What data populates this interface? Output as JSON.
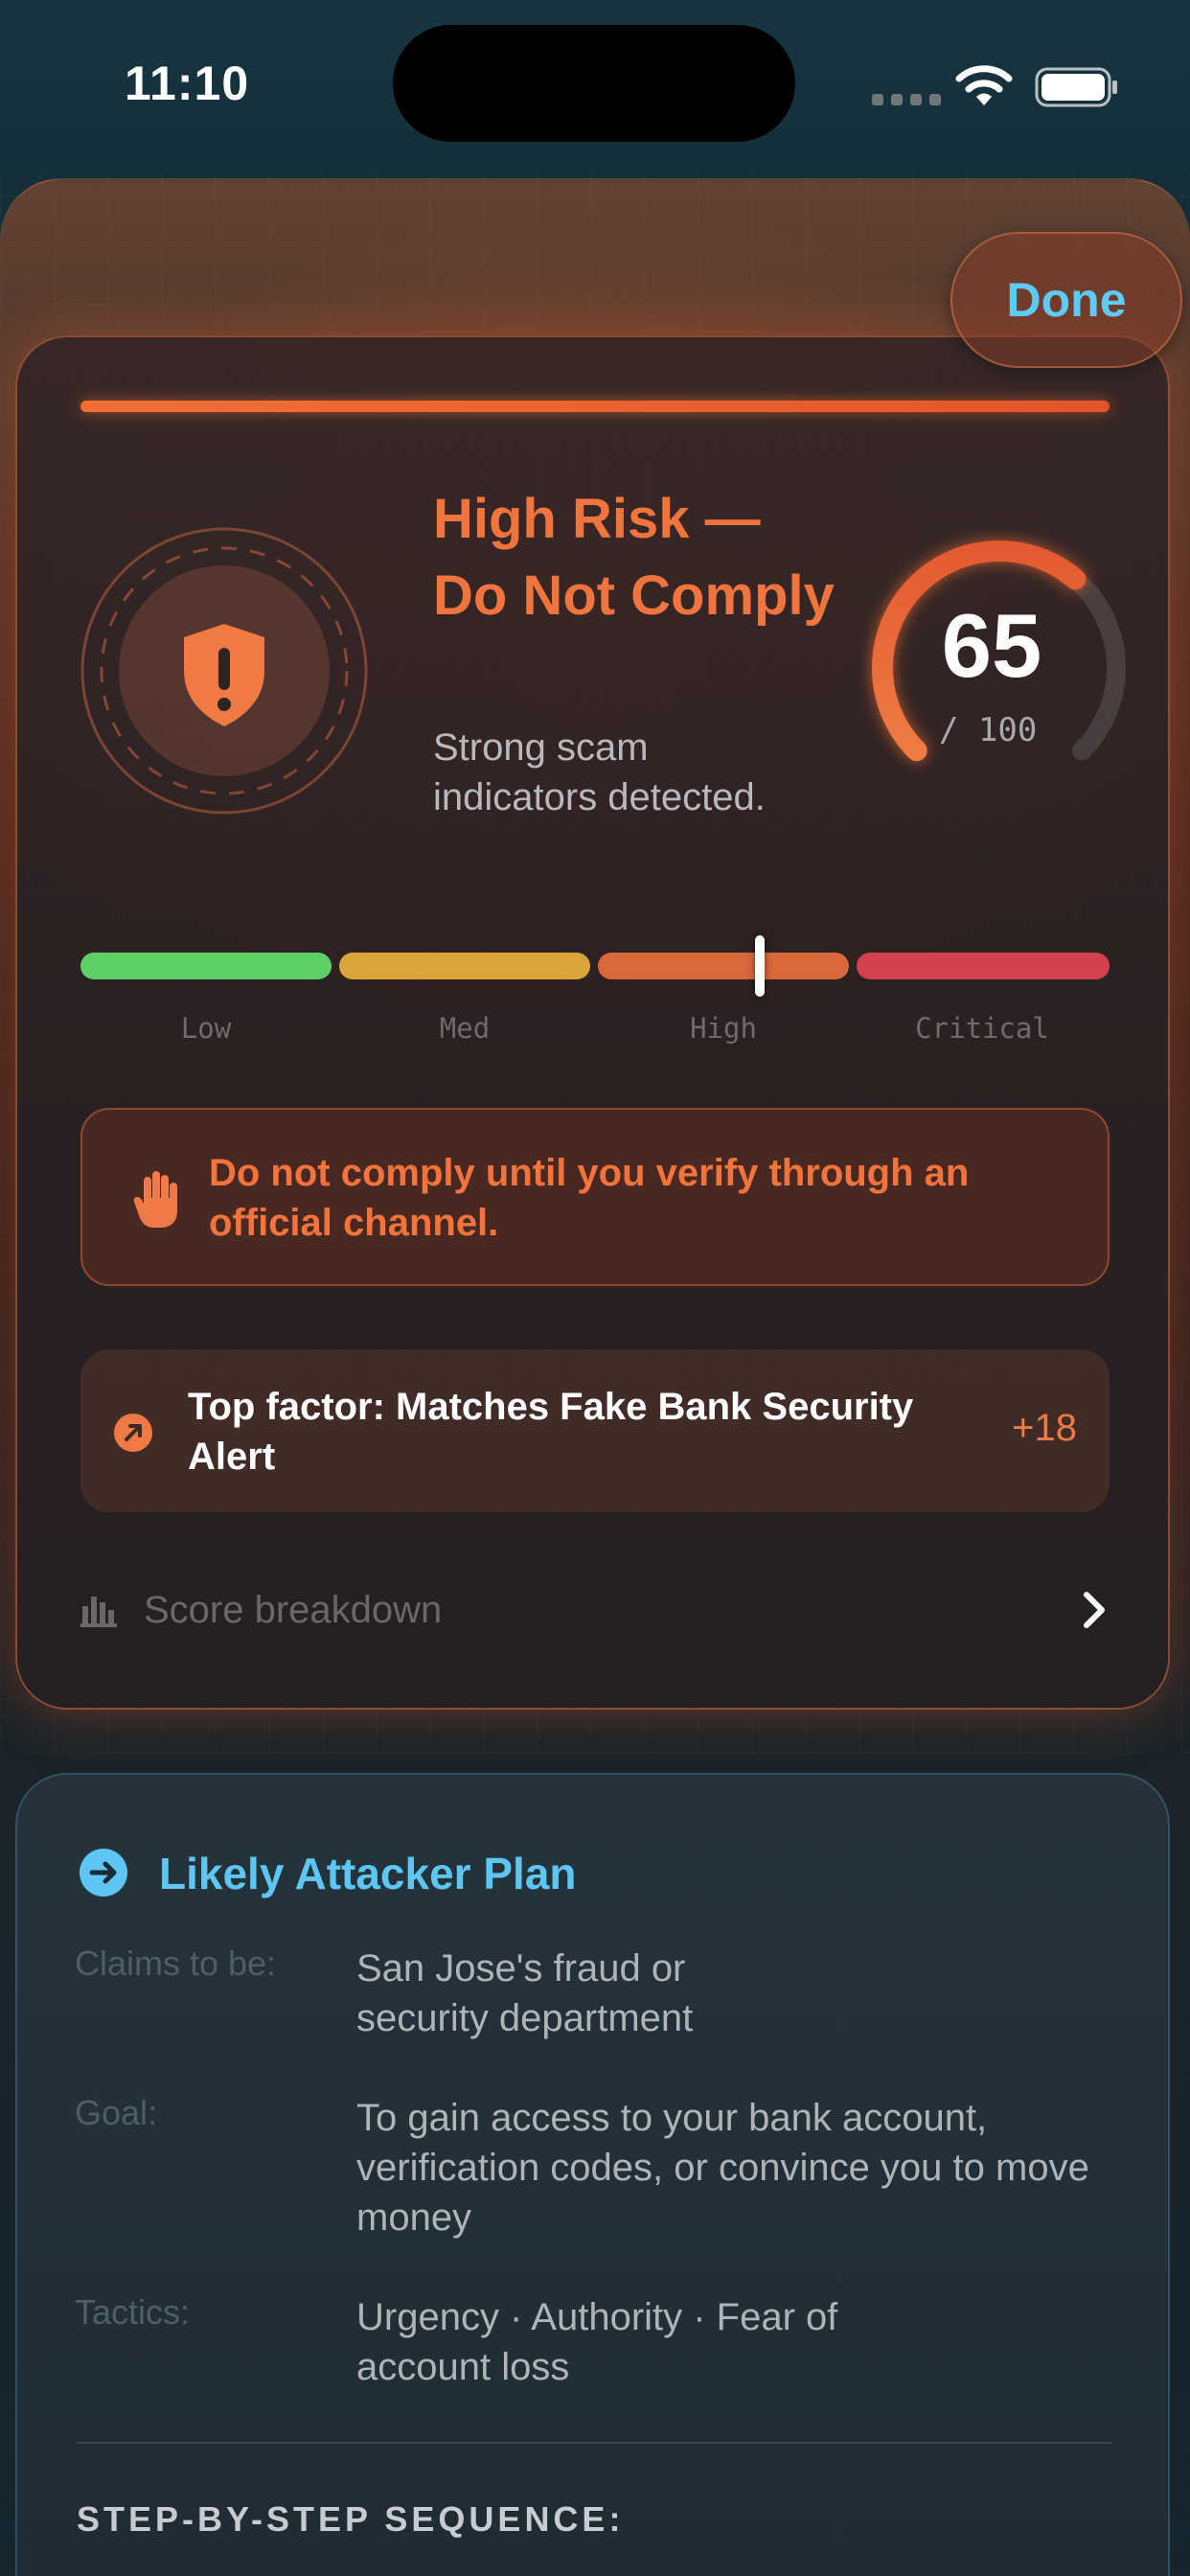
{
  "status_bar": {
    "time": "11:10"
  },
  "header": {
    "done_label": "Done"
  },
  "risk": {
    "title": "High Risk — Do Not Comply",
    "subtitle": "Strong scam indicators detected.",
    "score": "65",
    "score_max": "/ 100",
    "score_fraction": 0.65,
    "scale_labels": [
      "Low",
      "Med",
      "High",
      "Critical"
    ],
    "scale_position_fraction": 0.66,
    "accent_color": "#f0743e"
  },
  "warning": {
    "text": "Do not comply until you verify through an official channel."
  },
  "top_factor": {
    "text": "Top factor: Matches Fake Bank Security Alert",
    "score": "+18"
  },
  "breakdown": {
    "label": "Score breakdown"
  },
  "attacker_plan": {
    "title": "Likely Attacker Plan",
    "rows": [
      {
        "key": "Claims to be:",
        "value": "San Jose's fraud or security department"
      },
      {
        "key": "Goal:",
        "value": "To gain access to your bank account, verification codes, or convince you to move money"
      },
      {
        "key": "Tactics:",
        "value": "Urgency · Authority · Fear of account loss"
      }
    ],
    "sequence_heading": "STEP-BY-STEP SEQUENCE:"
  },
  "icons": {
    "shield": "shield-exclamation-icon",
    "hand": "raised-hand-icon",
    "factor": "arrow-up-right-circle-icon",
    "breakdown": "bar-chart-icon",
    "chevron": "chevron-right-icon",
    "plan": "arrow-right-circle-icon"
  }
}
